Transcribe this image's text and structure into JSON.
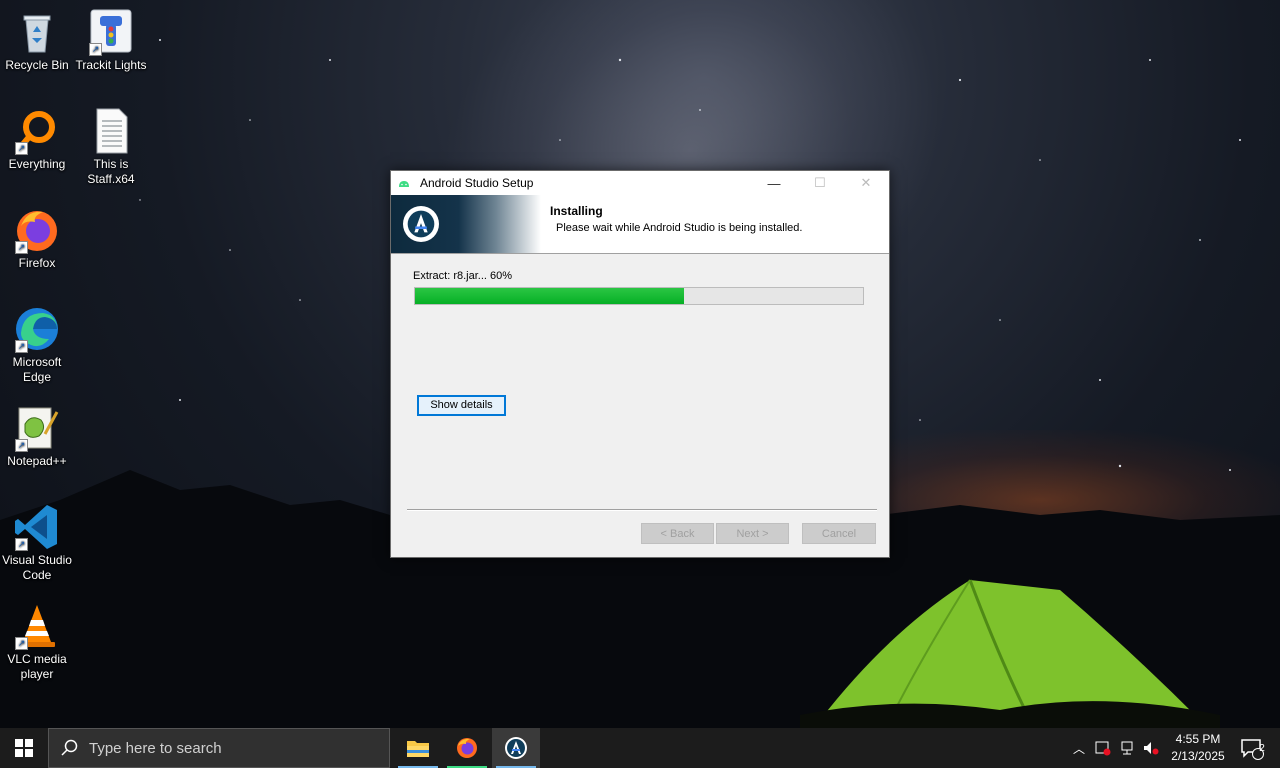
{
  "desktop": {
    "icons": [
      {
        "label": "Recycle Bin"
      },
      {
        "label": "Trackit Lights"
      },
      {
        "label": "Everything"
      },
      {
        "label": "This is Staff.x64"
      },
      {
        "label": "Firefox"
      },
      {
        "label": "Microsoft Edge"
      },
      {
        "label": "Notepad++"
      },
      {
        "label": "Visual Studio Code"
      },
      {
        "label": "VLC media player"
      }
    ]
  },
  "window": {
    "title": "Android Studio Setup",
    "header_title": "Installing",
    "header_subtitle": "Please wait while Android Studio is being installed.",
    "status_text": "Extract: r8.jar... 60%",
    "progress": 0.6,
    "progress_color": "#06b025",
    "show_details_label": "Show details",
    "back_label": "< Back",
    "next_label": "Next >",
    "cancel_label": "Cancel"
  },
  "taskbar": {
    "search_placeholder": "Type here to search",
    "time": "4:55 PM",
    "date": "2/13/2025",
    "notification_count": "2",
    "apps": [
      {
        "icon": "file-explorer-icon"
      },
      {
        "icon": "firefox-icon"
      },
      {
        "icon": "android-studio-icon"
      }
    ]
  }
}
